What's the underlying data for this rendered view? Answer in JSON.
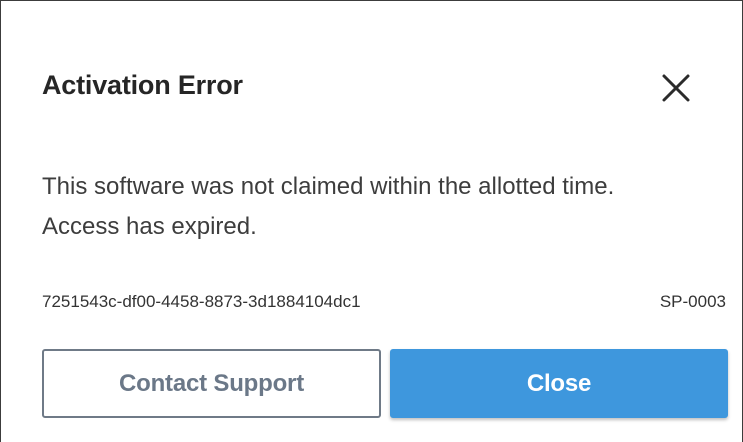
{
  "dialog": {
    "title": "Activation Error",
    "close_icon": "close-icon",
    "message_lines": [
      "This software was not claimed within the allotted time.",
      "Access has expired."
    ],
    "activation_id": "7251543c-df00-4458-8873-3d1884104dc1",
    "error_code": "SP-0003",
    "buttons": {
      "contact_support": "Contact Support",
      "close": "Close"
    }
  },
  "colors": {
    "primary_button": "#3e97dd",
    "secondary_button_border": "#6f7a87",
    "secondary_button_text": "#6b7888",
    "title_text": "#262626"
  }
}
